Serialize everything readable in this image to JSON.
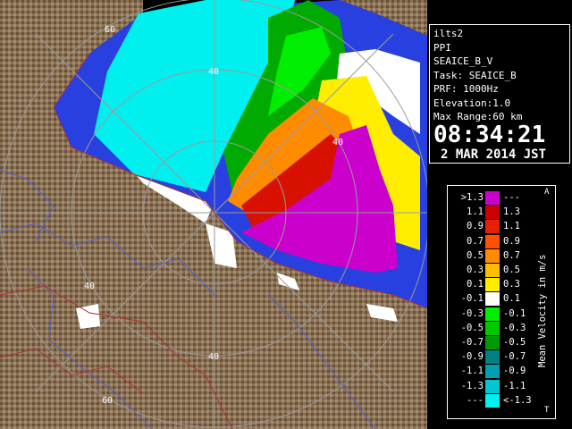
{
  "radar_info": {
    "site": "ilts2",
    "product": "PPI",
    "field": "SEAICE_B_V",
    "task": "Task: SEAICE_B",
    "prf": "PRF: 1000Hz",
    "elevation": "Elevation:1.0",
    "max_range": "Max Range:60 km",
    "time": "08:34:21",
    "date": "2 MAR 2014 JST"
  },
  "range_ring_labels": [
    "60",
    "40",
    "40",
    "40",
    "40",
    "60"
  ],
  "legend": {
    "title": "Mean Velocity in m/s",
    "corner_top": "A",
    "corner_bottom": "T",
    "rows": [
      {
        "left": ">1.3",
        "color": "#cc00cc",
        "right": "---"
      },
      {
        "left": "1.1",
        "color": "#c80000",
        "right": "1.3"
      },
      {
        "left": "0.9",
        "color": "#e82000",
        "right": "1.1"
      },
      {
        "left": "0.7",
        "color": "#ff5000",
        "right": "0.9"
      },
      {
        "left": "0.5",
        "color": "#ff8c00",
        "right": "0.7"
      },
      {
        "left": "0.3",
        "color": "#ffbe00",
        "right": "0.5"
      },
      {
        "left": "0.1",
        "color": "#ffee00",
        "right": "0.3"
      },
      {
        "left": "-0.1",
        "color": "#ffffff",
        "right": "0.1"
      },
      {
        "left": "-0.3",
        "color": "#00ee00",
        "right": "-0.1"
      },
      {
        "left": "-0.5",
        "color": "#00c800",
        "right": "-0.3"
      },
      {
        "left": "-0.7",
        "color": "#009a00",
        "right": "-0.5"
      },
      {
        "left": "-0.9",
        "color": "#008080",
        "right": "-0.7"
      },
      {
        "left": "-1.1",
        "color": "#00a0b4",
        "right": "-0.9"
      },
      {
        "left": "-1.3",
        "color": "#00c8d2",
        "right": "-1.1"
      },
      {
        "left": "---",
        "color": "#00f0f0",
        "right": "<-1.3"
      }
    ]
  },
  "colors": {
    "land": "#8a7256",
    "sea_ice": "#2840e0",
    "ring": "#9a9a9a",
    "road_red": "#b03030",
    "road_blue": "#5060d0"
  }
}
